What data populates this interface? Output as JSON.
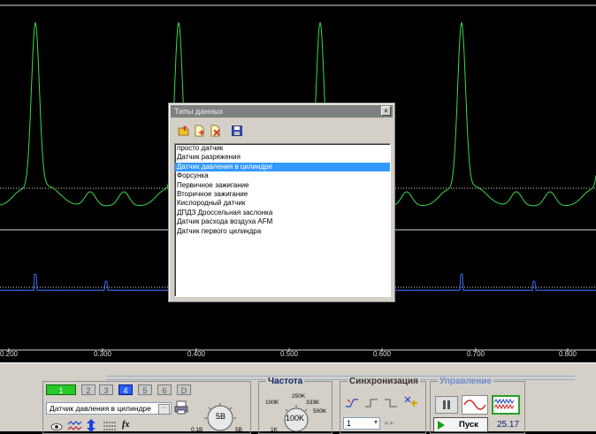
{
  "scope": {
    "colors": {
      "green": "#3ad94a",
      "blue": "#3f6df2",
      "grid": "#d8d8d8"
    },
    "x_ticks": [
      "0.200",
      "0.300",
      "0.400",
      "0.500",
      "0.600",
      "0.700",
      "0.800"
    ]
  },
  "dialog": {
    "title": "Типы данных",
    "close_label": "×",
    "toolbar_icons": [
      "open-folder-icon",
      "add-file-icon",
      "delete-file-icon",
      "save-disk-icon"
    ],
    "items": [
      {
        "label": "просто датчик",
        "selected": false
      },
      {
        "label": "Датчик разряжения",
        "selected": false
      },
      {
        "label": "Датчик давления в цилиндре",
        "selected": true
      },
      {
        "label": "Форсунка",
        "selected": false
      },
      {
        "label": "Первичное зажигание",
        "selected": false
      },
      {
        "label": "Вторичное зажигание",
        "selected": false
      },
      {
        "label": "Кислородный датчик",
        "selected": false
      },
      {
        "label": "ДПДЗ Дроссельная заслонка",
        "selected": false
      },
      {
        "label": "Датчик расхода воздуха AFM",
        "selected": false
      },
      {
        "label": "Датчик первого цилиндра",
        "selected": false
      }
    ]
  },
  "panel": {
    "channels": [
      "1",
      "2",
      "3",
      "4",
      "5",
      "6",
      "D"
    ],
    "sensor_value": "Датчик давления в цилиндре",
    "sensor_btn": "···",
    "fx_label": "fx",
    "volt_knob": {
      "value": "5В",
      "min": "0.1В",
      "max": "5В"
    },
    "freq": {
      "title": "Частота",
      "value": "100K",
      "labels": [
        "100K",
        "250K",
        "333K",
        "500K",
        "1K"
      ]
    },
    "sync": {
      "title": "Синхронизация",
      "value": "1"
    },
    "control": {
      "title": "Управление",
      "start": "Пуск",
      "readout": "25.17"
    }
  }
}
